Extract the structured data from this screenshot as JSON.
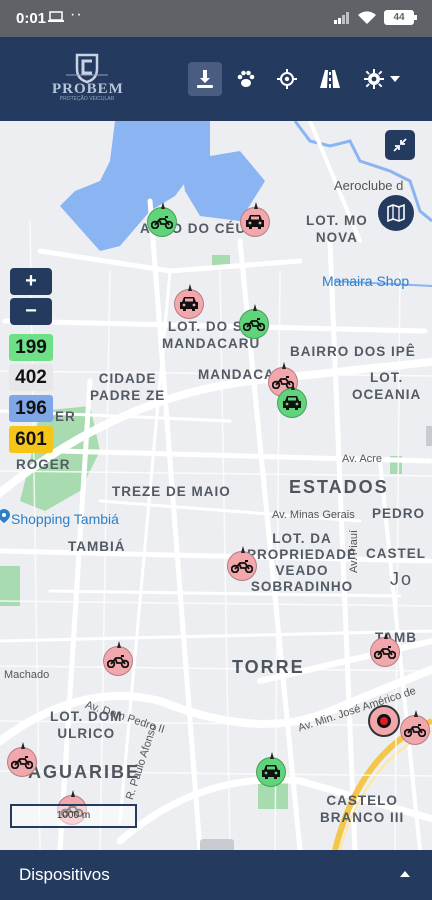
{
  "status_bar": {
    "time": "0:01",
    "battery": "44"
  },
  "header": {
    "logo_text": "PROBEM",
    "logo_subtext": "PROTEÇÃO VEICULAR",
    "buttons": [
      {
        "icon": "download-icon",
        "active": true
      },
      {
        "icon": "paw-icon"
      },
      {
        "icon": "crosshair-icon"
      },
      {
        "icon": "road-icon"
      },
      {
        "icon": "gear-icon"
      }
    ]
  },
  "map": {
    "zoom_in": "+",
    "zoom_out": "−",
    "counts": [
      {
        "value": "199",
        "color": "#6ee087"
      },
      {
        "value": "402",
        "color": "#e7e7ea"
      },
      {
        "value": "196",
        "color": "#7fa6e6"
      },
      {
        "value": "601",
        "color": "#f5c518"
      }
    ],
    "labels": {
      "aeroclube": "Aeroclube d",
      "aero_do_ceu": "AERO DO CÉU",
      "lot_mo_nova": "LOT. MO\nNOVA",
      "manaira_shop": "Manaira Shop",
      "lot_do_so_mandacaru": "LOT. DO SO\nMANDACARU",
      "bairro_dos_ipe": "BAIRRO DOS IPÊ",
      "cidade_padre_ze": "CIDADE\nPADRE ZE",
      "mandacaru": "MANDACA",
      "oceania": "LOT.\nOCEANIA",
      "xinger": "XINGER",
      "roger": "ROGER",
      "av_acre": "Av. Acre",
      "treze_de_maio": "TREZE DE MAIO",
      "estados": "ESTADOS",
      "shopping_tambia": "Shopping Tambiá",
      "av_minas_gerais": "Av. Minas Gerais",
      "pedro": "PEDRO",
      "tambia": "TAMBIÁ",
      "lot_da_propriedade": "LOT. DA\nPROPRIEDADE\nVEADO\nSOBRADINHO",
      "castel": "CASTEL",
      "jo": "Jo",
      "tamb": "TAMB",
      "torre": "TORRE",
      "machado": "Machado",
      "av_dom_pedro": "Av. Dom Pedro II",
      "lot_dom_ulrico": "LOT. DOM\nULRICO",
      "av_jose_americo": "Av. Min. José Américo de",
      "jaguaribe": "AGUARIBE",
      "castelo_branco": "CASTELO\nBRANCO III",
      "av_paulo_afonso": "R. Paulo Afonso",
      "av_piaui": "Av. Piauí"
    },
    "scale": "1000 m",
    "markers": [
      {
        "type": "motorcycle",
        "color": "green"
      },
      {
        "type": "car",
        "color": "pink"
      },
      {
        "type": "car",
        "color": "pink"
      },
      {
        "type": "motorcycle",
        "color": "green"
      },
      {
        "type": "motorcycle",
        "color": "pink"
      },
      {
        "type": "car",
        "color": "green"
      },
      {
        "type": "motorcycle",
        "color": "pink"
      },
      {
        "type": "motorcycle",
        "color": "pink"
      },
      {
        "type": "motorcycle",
        "color": "pink"
      },
      {
        "type": "motorcycle",
        "color": "pink"
      },
      {
        "type": "car",
        "color": "green"
      },
      {
        "type": "motorcycle",
        "color": "pink"
      },
      {
        "type": "motorcycle",
        "color": "pink"
      }
    ]
  },
  "bottom_panel": {
    "title": "Dispositivos"
  }
}
